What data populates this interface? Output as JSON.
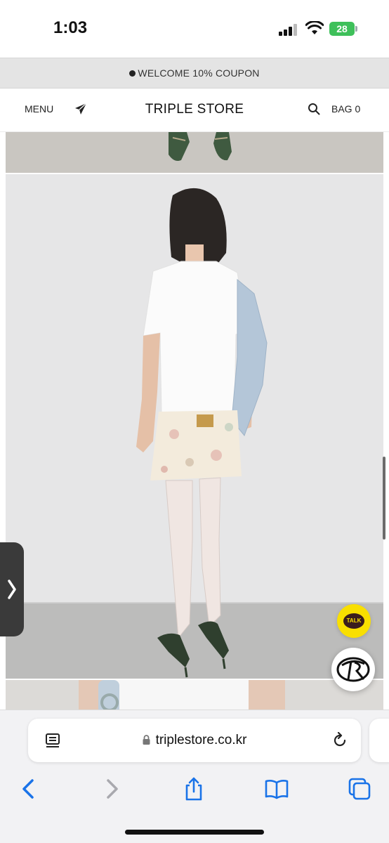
{
  "status_bar": {
    "time": "1:03",
    "battery": "28"
  },
  "announcement": {
    "text": "WELCOME 10% COUPON"
  },
  "header": {
    "menu_label": "MENU",
    "title": "TRIPLE STORE",
    "bag_label": "BAG 0"
  },
  "chat": {
    "talk_label": "TALK"
  },
  "browser": {
    "url": "triplestore.co.kr"
  },
  "icons": {
    "send": "paper-plane-icon",
    "search": "search-icon",
    "reader": "reader-icon",
    "lock": "lock-icon",
    "reload": "reload-icon",
    "back": "chevron-left-icon",
    "forward": "chevron-right-icon",
    "share": "share-icon",
    "bookmarks": "book-icon",
    "tabs": "tabs-icon"
  },
  "colors": {
    "accent_blue": "#1a73e8",
    "talk_yellow": "#f9df00",
    "battery_green": "#3ec05a"
  }
}
